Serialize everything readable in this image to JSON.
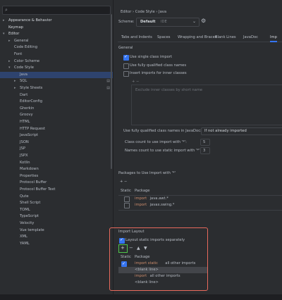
{
  "search": {
    "placeholder": "",
    "icon": "search-icon"
  },
  "tree": [
    {
      "label": "Appearance & Behavior",
      "depth": 0,
      "arrow": "▸",
      "bold": true
    },
    {
      "label": "Keymap",
      "depth": 0,
      "arrow": "",
      "bold": true
    },
    {
      "label": "Editor",
      "depth": 0,
      "arrow": "▾",
      "bold": true
    },
    {
      "label": "General",
      "depth": 1,
      "arrow": "▸"
    },
    {
      "label": "Code Editing",
      "depth": 1,
      "arrow": ""
    },
    {
      "label": "Font",
      "depth": 1,
      "arrow": ""
    },
    {
      "label": "Color Scheme",
      "depth": 1,
      "arrow": "▸"
    },
    {
      "label": "Code Style",
      "depth": 1,
      "arrow": "▾"
    },
    {
      "label": "Java",
      "depth": 2,
      "arrow": "",
      "selected": true
    },
    {
      "label": "SQL",
      "depth": 2,
      "arrow": "▸",
      "projIcon": true
    },
    {
      "label": "Style Sheets",
      "depth": 2,
      "arrow": "▸",
      "projIcon": true
    },
    {
      "label": "Dart",
      "depth": 2,
      "arrow": ""
    },
    {
      "label": "EditorConfig",
      "depth": 2,
      "arrow": ""
    },
    {
      "label": "Gherkin",
      "depth": 2,
      "arrow": ""
    },
    {
      "label": "Groovy",
      "depth": 2,
      "arrow": ""
    },
    {
      "label": "HTML",
      "depth": 2,
      "arrow": ""
    },
    {
      "label": "HTTP Request",
      "depth": 2,
      "arrow": ""
    },
    {
      "label": "JavaScript",
      "depth": 2,
      "arrow": ""
    },
    {
      "label": "JSON",
      "depth": 2,
      "arrow": ""
    },
    {
      "label": "JSP",
      "depth": 2,
      "arrow": ""
    },
    {
      "label": "JSPX",
      "depth": 2,
      "arrow": ""
    },
    {
      "label": "Kotlin",
      "depth": 2,
      "arrow": ""
    },
    {
      "label": "Markdown",
      "depth": 2,
      "arrow": ""
    },
    {
      "label": "Properties",
      "depth": 2,
      "arrow": ""
    },
    {
      "label": "Protocol Buffer",
      "depth": 2,
      "arrow": ""
    },
    {
      "label": "Protocol Buffer Text",
      "depth": 2,
      "arrow": ""
    },
    {
      "label": "Qute",
      "depth": 2,
      "arrow": ""
    },
    {
      "label": "Shell Script",
      "depth": 2,
      "arrow": ""
    },
    {
      "label": "TOML",
      "depth": 2,
      "arrow": ""
    },
    {
      "label": "TypeScript",
      "depth": 2,
      "arrow": ""
    },
    {
      "label": "Velocity",
      "depth": 2,
      "arrow": ""
    },
    {
      "label": "Vue template",
      "depth": 2,
      "arrow": ""
    },
    {
      "label": "XML",
      "depth": 2,
      "arrow": ""
    },
    {
      "label": "YAML",
      "depth": 2,
      "arrow": ""
    }
  ],
  "breadcrumb": "Editor  ›  Code Style  ›  Java",
  "scheme": {
    "label": "Scheme:",
    "value": "Default",
    "suffix": "IDE"
  },
  "tabs": [
    "Tabs and Indents",
    "Spaces",
    "Wrapping and Braces",
    "Blank Lines",
    "JavaDoc",
    "Imp"
  ],
  "general": {
    "title": "General",
    "options": [
      {
        "label": "Use single class import",
        "checked": true
      },
      {
        "label": "Use fully qualified class names",
        "checked": false
      },
      {
        "label": "Insert imports for inner classes",
        "checked": false
      }
    ],
    "list_tools": "+  −",
    "exclude_placeholder": "Exclude inner classes by short name",
    "fqn_javadoc_label": "Use fully qualified class names in JavaDoc:",
    "fqn_javadoc_value": "If not already imported",
    "class_count_label": "Class count to use import with '*':",
    "class_count_value": "5",
    "names_count_label": "Names count to use static import with '*':",
    "names_count_value": "3"
  },
  "packages": {
    "title": "Packages to Use Import with '*'",
    "tools": "+  −",
    "col_static": "Static",
    "col_package": "Package",
    "rows": [
      {
        "keyword": "import",
        "package": "java.awt.*"
      },
      {
        "keyword": "import",
        "package": "javax.swing.*"
      }
    ]
  },
  "layout": {
    "title": "Import Layout",
    "separately_label": "Layout static imports separately",
    "separately_checked": true,
    "tools": [
      "+",
      "−",
      "▲",
      "▼"
    ],
    "col_static": "Static",
    "col_package": "Package",
    "rows": [
      {
        "type": "import",
        "keyword": "import static",
        "rest": "all other imports",
        "static": true,
        "selected": false
      },
      {
        "type": "blank",
        "text": "<blank line>",
        "selected": true
      },
      {
        "type": "import",
        "keyword": "import",
        "rest": "all other imports",
        "static": false,
        "selected": false
      },
      {
        "type": "blank",
        "text": "<blank line>",
        "selected": false
      }
    ]
  },
  "colors": {
    "accent": "#3574f0",
    "highlight_red": "#e86a5c",
    "highlight_green": "#4fc64a",
    "keyword": "#cf8e6d"
  }
}
